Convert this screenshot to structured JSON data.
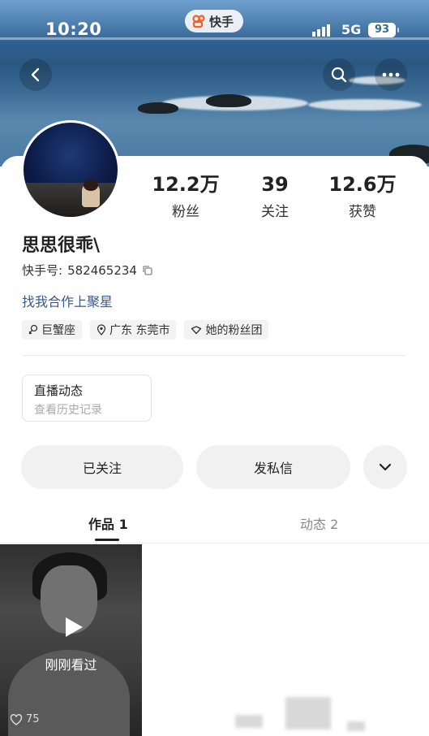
{
  "status_bar": {
    "time": "10:20",
    "app_name": "快手",
    "network": "5G",
    "battery": "93"
  },
  "profile": {
    "nickname": "思思很乖\\",
    "kwai_id_label": "快手号:",
    "kwai_id": "582465234",
    "biz_link": "找我合作上聚星",
    "stats": [
      {
        "value": "12.2万",
        "label": "粉丝"
      },
      {
        "value": "39",
        "label": "关注"
      },
      {
        "value": "12.6万",
        "label": "获赞"
      }
    ],
    "tags": [
      {
        "icon": "zodiac-icon",
        "label": "巨蟹座"
      },
      {
        "icon": "location-pin-icon",
        "label": "广东 东莞市"
      },
      {
        "icon": "fan-group-icon",
        "label": "她的粉丝团"
      }
    ]
  },
  "live_box": {
    "title": "直播动态",
    "subtitle": "查看历史记录"
  },
  "actions": {
    "follow_label": "已关注",
    "message_label": "发私信"
  },
  "tabs": [
    {
      "label": "作品 1",
      "active": true
    },
    {
      "label": "动态 2",
      "active": false
    }
  ],
  "works": [
    {
      "overlay_text": "刚刚看过",
      "likes": "75"
    }
  ],
  "colors": {
    "link": "#3a5a8a",
    "pill_bg": "#f1f1f1"
  }
}
